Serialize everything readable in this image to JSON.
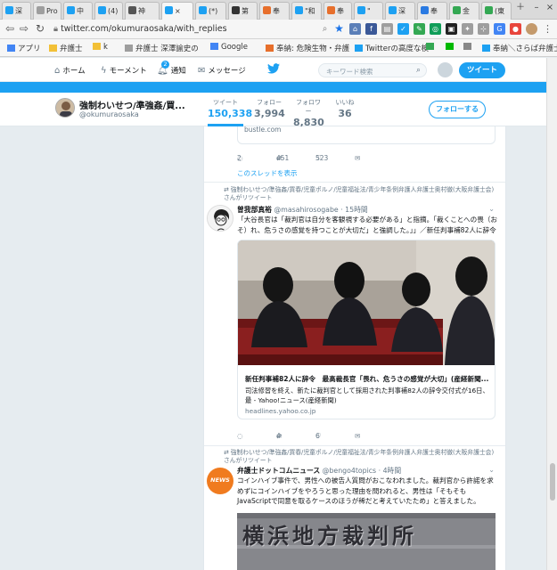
{
  "browser": {
    "tabs": [
      {
        "label": "深",
        "icon": "twitter-bird",
        "color": "#1da1f2"
      },
      {
        "label": "Pro",
        "icon": "page",
        "color": "#9e9e9e"
      },
      {
        "label": "中",
        "icon": "twitter-bird",
        "color": "#1da1f2"
      },
      {
        "label": "(4)",
        "icon": "twitter-bird",
        "color": "#1da1f2"
      },
      {
        "label": "神",
        "icon": "avatar",
        "color": "#555"
      },
      {
        "label": "×",
        "icon": "twitter-bird",
        "color": "#1da1f2",
        "active": true
      },
      {
        "label": "(*)",
        "icon": "twitter-bird",
        "color": "#1da1f2"
      },
      {
        "label": "第",
        "icon": "wikipedia",
        "color": "#333"
      },
      {
        "label": "奉",
        "icon": "hatena",
        "color": "#e76f2c"
      },
      {
        "label": "\"和",
        "icon": "twitter-bird",
        "color": "#1da1f2"
      },
      {
        "label": "奉",
        "icon": "hatena",
        "color": "#e76f2c"
      },
      {
        "label": "\"",
        "icon": "twitter-bird",
        "color": "#1da1f2"
      },
      {
        "label": "深",
        "icon": "twitter-bird",
        "color": "#1da1f2"
      },
      {
        "label": "奉",
        "icon": "page",
        "color": "#2a7ae2"
      },
      {
        "label": "金",
        "icon": "maps",
        "color": "#34a853"
      },
      {
        "label": "(東",
        "icon": "maps",
        "color": "#34a853"
      }
    ],
    "url": "twitter.com/okumuraosaka/with_replies",
    "bookmarks": [
      {
        "label": "アプリ",
        "icon": "apps-icon"
      },
      {
        "label": "弁護士",
        "icon": "folder-icon"
      },
      {
        "label": "k",
        "icon": "folder-icon"
      },
      {
        "label": "弁護士 深澤諭史の",
        "icon": "page-icon"
      },
      {
        "label": "Google",
        "icon": "google-icon"
      },
      {
        "label": "奉納: 危険生物・弁護",
        "icon": "hatena-icon"
      },
      {
        "label": "Twitterの高度な検",
        "icon": "twitter-icon"
      },
      {
        "label": "",
        "icon": "evernote-icon"
      },
      {
        "label": "",
        "icon": "line-icon"
      },
      {
        "label": "",
        "icon": "misc-icon"
      },
      {
        "label": "奉納＼さらば弁護士",
        "icon": "twitter-icon"
      }
    ]
  },
  "twitter": {
    "nav": {
      "home": "ホーム",
      "moments": "モーメント",
      "notifications": "通知",
      "notifications_badge": "2",
      "messages": "メッセージ",
      "search_placeholder": "キーワード検索",
      "tweet_button": "ツイート"
    },
    "profile": {
      "name": "強制わいせつ/準強姦/買...",
      "handle": "@okumuraosaka",
      "stats": [
        {
          "label": "ツイート",
          "value": "150,338",
          "active": true
        },
        {
          "label": "フォロー",
          "value": "3,994"
        },
        {
          "label": "フォロワー",
          "value": "8,830"
        },
        {
          "label": "いいね",
          "value": "36"
        }
      ],
      "follow_button": "フォローする"
    },
    "timeline": {
      "prev_tweet": {
        "card_domain": "bustle.com",
        "replies": "2",
        "retweets": "451",
        "likes": "523",
        "thread_link": "このスレッドを表示"
      },
      "tweet1": {
        "retweet_note": "強制わいせつ/準強姦/買春/児童ポルノ/児童福祉法/青少年条例弁護人弁護士奥村徹(大阪弁護士会)さんがリツイート",
        "name": "曽我部真裕",
        "handle": "@masahirosogabe",
        "time": "· 15時間",
        "text": "「大谷長官は「裁判官は自分を客観視する必要がある」と指摘。「裁くことへの畏（おそ）れ、危うさの感覚を持つことが大切だ」と強調した。」」／新任判事補82人に辞令",
        "card_title": "新任判事補82人に辞令　最高裁長官「畏れ、危うさの感覚が大切」(産経新聞...",
        "card_desc": "司法修習を終え、新たに裁判官として採用された判事補82人の辞令交付式が16日、最 - Yahoo!ニュース(産経新聞)",
        "card_domain": "headlines.yahoo.co.jp",
        "replies": "",
        "retweets": "4",
        "likes": "6"
      },
      "tweet2": {
        "retweet_note": "強制わいせつ/準強姦/買春/児童ポルノ/児童福祉法/青少年条例弁護人弁護士奥村徹(大阪弁護士会)さんがリツイート",
        "name": "弁護士ドットコムニュース",
        "handle": "@bengo4topics",
        "time": "· 4時間",
        "avatar_text": "NEWS",
        "text": "コインハイブ事件で、男性への被告人質問がおこなわれました。裁判官から許諾を求めずにコインハイブをやろうと思った理由を問われると、男性は「そもそもJavaScriptで同意を取るケースのほうが稀だと考えていたため」と答えました。",
        "image_text": "横浜地方裁判所"
      }
    }
  },
  "colors": {
    "twitter_blue": "#1da1f2",
    "secondary_text": "#657786",
    "border": "#e1e8ed"
  }
}
